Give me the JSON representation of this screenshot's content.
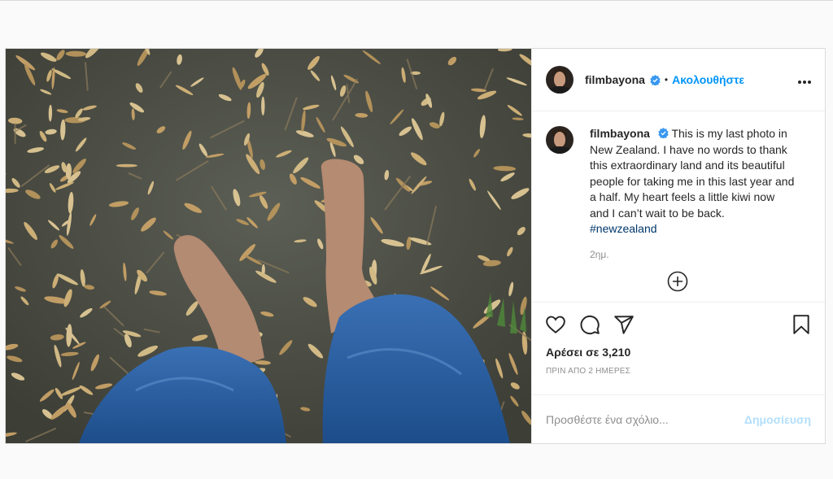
{
  "post": {
    "photo_alt": "",
    "author": {
      "username": "filmbayona",
      "verified": true
    },
    "header": {
      "separator": "•",
      "follow_label": "Ακολουθήστε",
      "more_label": "•••"
    },
    "caption": {
      "username": "filmbayona",
      "text": "This is my last photo in New Zealand. I have no words to thank this extraordinary land and its beautiful people for taking me in this last year and a half. My heart feels a little kiwi now and I can’t wait to be back. ",
      "hashtag": "#newzealand",
      "time": "2ημ."
    },
    "actions": {
      "like_icon": "heart-icon",
      "comment_icon": "comment-icon",
      "share_icon": "share-icon",
      "save_icon": "bookmark-icon"
    },
    "likes_text": "Αρέσει σε 3,210",
    "posted_ago": "ΠΡΙΝ ΑΠΟ 2 ΗΜΕΡΕΣ",
    "comment_box": {
      "placeholder": "Προσθέστε ένα σχόλιο...",
      "publish_label": "Δημοσίευση"
    },
    "colors": {
      "accent": "#0095f6",
      "publish_disabled": "#b2dffc",
      "hashtag": "#00376b",
      "muted": "#8e8e8e"
    }
  }
}
